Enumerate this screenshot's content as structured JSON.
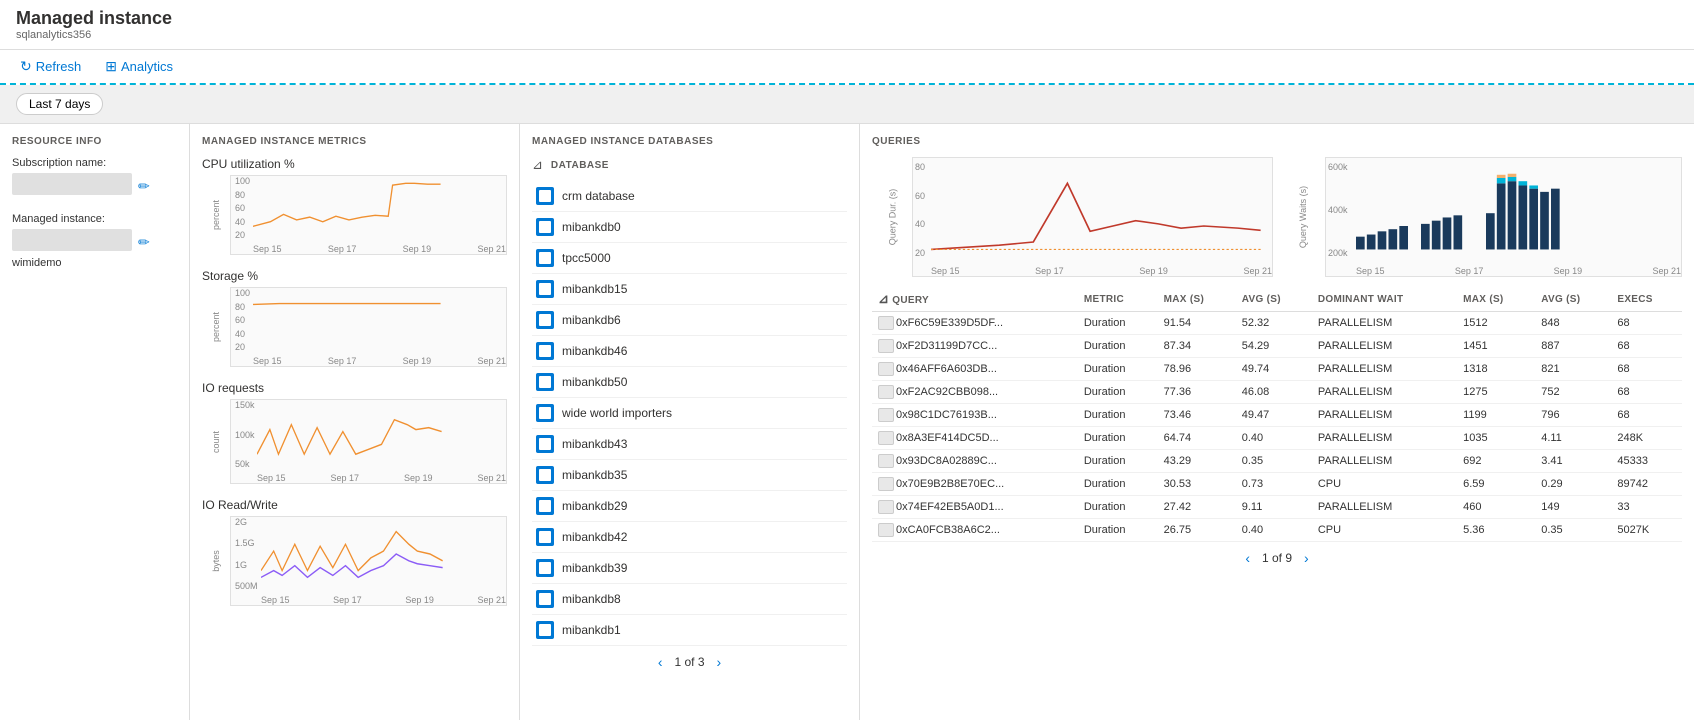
{
  "header": {
    "title": "Managed instance",
    "subtitle": "sqlanalytics356"
  },
  "toolbar": {
    "refresh_label": "Refresh",
    "analytics_label": "Analytics"
  },
  "filter": {
    "time_range": "Last 7 days"
  },
  "resource_info": {
    "section_label": "RESOURCE INFO",
    "subscription_label": "Subscription name:",
    "managed_instance_label": "Managed instance:",
    "managed_instance_value": "wimidemo"
  },
  "metrics": {
    "section_label": "MANAGED INSTANCE METRICS",
    "charts": [
      {
        "title": "CPU utilization %",
        "y_label": "percent",
        "y_ticks": [
          "20",
          "40",
          "60",
          "80",
          "100"
        ],
        "x_ticks": [
          "Sep 15",
          "Sep 17",
          "Sep 19",
          "Sep 21"
        ]
      },
      {
        "title": "Storage %",
        "y_label": "percent",
        "y_ticks": [
          "20",
          "40",
          "60",
          "80",
          "100"
        ],
        "x_ticks": [
          "Sep 15",
          "Sep 17",
          "Sep 19",
          "Sep 21"
        ]
      },
      {
        "title": "IO requests",
        "y_label": "count",
        "y_ticks": [
          "50k",
          "100k",
          "150k"
        ],
        "x_ticks": [
          "Sep 15",
          "Sep 17",
          "Sep 19",
          "Sep 21"
        ]
      },
      {
        "title": "IO Read/Write",
        "y_label": "bytes",
        "y_ticks": [
          "500M",
          "1G",
          "1.5G",
          "2G"
        ],
        "x_ticks": [
          "Sep 15",
          "Sep 17",
          "Sep 19",
          "Sep 21"
        ]
      }
    ]
  },
  "databases": {
    "section_label": "MANAGED INSTANCE DATABASES",
    "col_label": "DATABASE",
    "items": [
      "crm database",
      "mibankdb0",
      "tpcc5000",
      "mibankdb15",
      "mibankdb6",
      "mibankdb46",
      "mibankdb50",
      "wide world importers",
      "mibankdb43",
      "mibankdb35",
      "mibankdb29",
      "mibankdb42",
      "mibankdb39",
      "mibankdb8",
      "mibankdb1"
    ],
    "pagination": "1 of 3"
  },
  "queries": {
    "section_label": "QUERIES",
    "left_chart_y_label": "Query Dur. (s)",
    "left_chart_y_ticks": [
      "20",
      "40",
      "60",
      "80"
    ],
    "left_chart_x_ticks": [
      "Sep 15",
      "Sep 17",
      "Sep 19",
      "Sep 21"
    ],
    "right_chart_y_label": "Query Waits (s)",
    "right_chart_y_ticks": [
      "200k",
      "400k",
      "600k"
    ],
    "right_chart_x_ticks": [
      "Sep 15",
      "Sep 17",
      "Sep 19",
      "Sep 21"
    ],
    "table": {
      "columns": [
        "QUERY",
        "METRIC",
        "MAX (S)",
        "AVG (S)",
        "DOMINANT WAIT",
        "MAX (S)",
        "AVG (S)",
        "EXECS"
      ],
      "rows": [
        {
          "query": "0xF6C59E339D5DF...",
          "metric": "Duration",
          "max": "91.54",
          "avg": "52.32",
          "dominant_wait": "PARALLELISM",
          "dw_max": "1512",
          "dw_avg": "848",
          "execs": "68"
        },
        {
          "query": "0xF2D31199D7CC...",
          "metric": "Duration",
          "max": "87.34",
          "avg": "54.29",
          "dominant_wait": "PARALLELISM",
          "dw_max": "1451",
          "dw_avg": "887",
          "execs": "68"
        },
        {
          "query": "0x46AFF6A603DB...",
          "metric": "Duration",
          "max": "78.96",
          "avg": "49.74",
          "dominant_wait": "PARALLELISM",
          "dw_max": "1318",
          "dw_avg": "821",
          "execs": "68"
        },
        {
          "query": "0xF2AC92CBB098...",
          "metric": "Duration",
          "max": "77.36",
          "avg": "46.08",
          "dominant_wait": "PARALLELISM",
          "dw_max": "1275",
          "dw_avg": "752",
          "execs": "68"
        },
        {
          "query": "0x98C1DC76193B...",
          "metric": "Duration",
          "max": "73.46",
          "avg": "49.47",
          "dominant_wait": "PARALLELISM",
          "dw_max": "1199",
          "dw_avg": "796",
          "execs": "68"
        },
        {
          "query": "0x8A3EF414DC5D...",
          "metric": "Duration",
          "max": "64.74",
          "avg": "0.40",
          "dominant_wait": "PARALLELISM",
          "dw_max": "1035",
          "dw_avg": "4.11",
          "execs": "248K"
        },
        {
          "query": "0x93DC8A02889C...",
          "metric": "Duration",
          "max": "43.29",
          "avg": "0.35",
          "dominant_wait": "PARALLELISM",
          "dw_max": "692",
          "dw_avg": "3.41",
          "execs": "45333"
        },
        {
          "query": "0x70E9B2B8E70EC...",
          "metric": "Duration",
          "max": "30.53",
          "avg": "0.73",
          "dominant_wait": "CPU",
          "dw_max": "6.59",
          "dw_avg": "0.29",
          "execs": "89742"
        },
        {
          "query": "0x74EF42EB5A0D1...",
          "metric": "Duration",
          "max": "27.42",
          "avg": "9.11",
          "dominant_wait": "PARALLELISM",
          "dw_max": "460",
          "dw_avg": "149",
          "execs": "33"
        },
        {
          "query": "0xCA0FCB38A6C2...",
          "metric": "Duration",
          "max": "26.75",
          "avg": "0.40",
          "dominant_wait": "CPU",
          "dw_max": "5.36",
          "dw_avg": "0.35",
          "execs": "5027K"
        }
      ]
    },
    "pagination": "1 of 9"
  },
  "colors": {
    "accent": "#0078d4",
    "orange": "#f09030",
    "purple": "#8b5cf6",
    "teal": "#00b4d8",
    "red": "#c0392b",
    "chart_line": "#f09030",
    "chart_line2": "#8b5cf6"
  }
}
